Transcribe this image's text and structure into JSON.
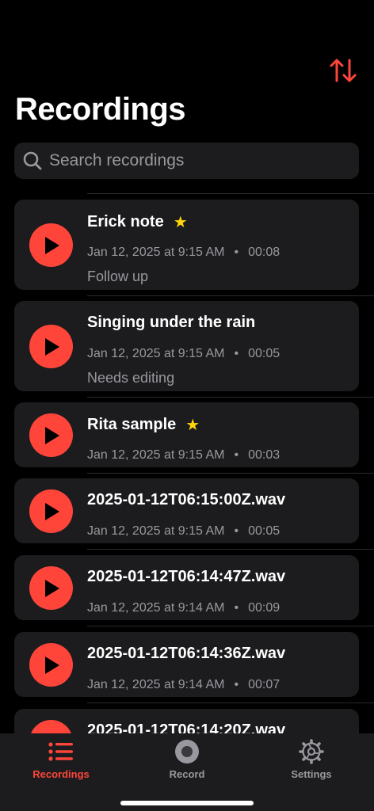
{
  "colors": {
    "accent": "#ff453a",
    "star": "#ffd60a",
    "card": "#1c1c1e",
    "secondary": "#98989e"
  },
  "header": {
    "title": "Recordings",
    "sort_icon": "sort-arrows-icon"
  },
  "search": {
    "placeholder": "Search recordings",
    "value": ""
  },
  "recordings": [
    {
      "title": "Erick note",
      "starred": true,
      "date": "Jan 12, 2025 at 9:15 AM",
      "duration": "00:08",
      "note": "Follow up"
    },
    {
      "title": "Singing under the rain",
      "starred": false,
      "date": "Jan 12, 2025 at 9:15 AM",
      "duration": "00:05",
      "note": "Needs editing"
    },
    {
      "title": "Rita sample",
      "starred": true,
      "date": "Jan 12, 2025 at 9:15 AM",
      "duration": "00:03",
      "note": ""
    },
    {
      "title": "2025-01-12T06:15:00Z.wav",
      "starred": false,
      "date": "Jan 12, 2025 at 9:15 AM",
      "duration": "00:05",
      "note": ""
    },
    {
      "title": "2025-01-12T06:14:47Z.wav",
      "starred": false,
      "date": "Jan 12, 2025 at 9:14 AM",
      "duration": "00:09",
      "note": ""
    },
    {
      "title": "2025-01-12T06:14:36Z.wav",
      "starred": false,
      "date": "Jan 12, 2025 at 9:14 AM",
      "duration": "00:07",
      "note": ""
    },
    {
      "title": "2025-01-12T06:14:20Z.wav",
      "starred": false,
      "date": "",
      "duration": "",
      "note": ""
    }
  ],
  "meta_separator": "•",
  "star_glyph": "★",
  "tabs": [
    {
      "label": "Recordings",
      "icon": "list-icon",
      "active": true
    },
    {
      "label": "Record",
      "icon": "record-icon",
      "active": false
    },
    {
      "label": "Settings",
      "icon": "gear-icon",
      "active": false
    }
  ]
}
